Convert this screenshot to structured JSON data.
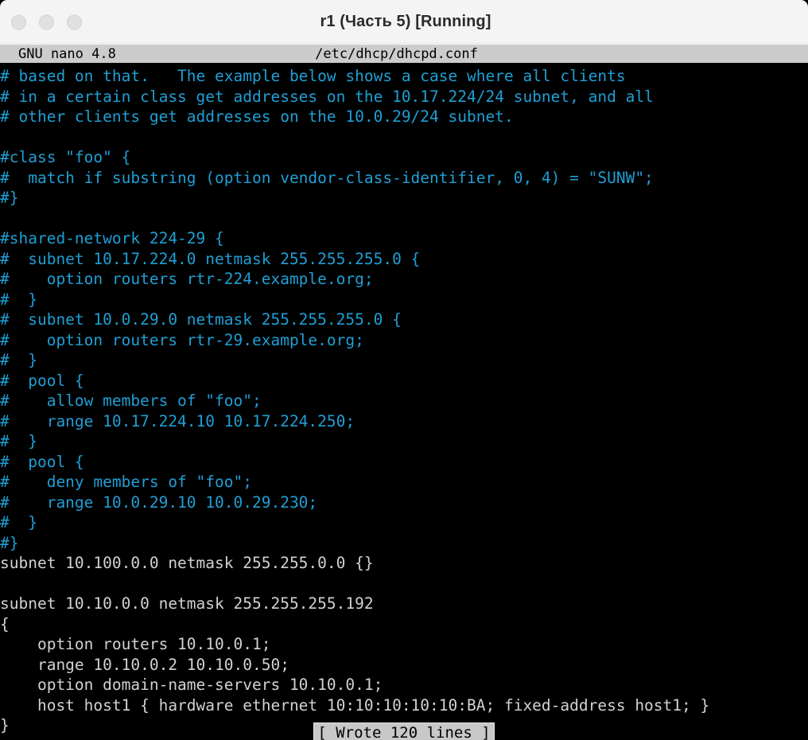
{
  "window": {
    "title": "r1 (Часть 5) [Running]",
    "controls": [
      {
        "name": "close-button",
        "label": ""
      },
      {
        "name": "minimize-button",
        "label": ""
      },
      {
        "name": "maximize-button",
        "label": ""
      }
    ]
  },
  "editor": {
    "app_name": "GNU nano 4.8",
    "file_path": "/etc/dhcp/dhcpd.conf",
    "status_message": "[ Wrote 120 lines ]",
    "colors": {
      "background": "#000000",
      "comment": "#1f9fd4",
      "text": "#d2d2d2",
      "header_bg": "#cccccc",
      "header_fg": "#000000",
      "titlebar_bg": "#f4f4f4"
    },
    "lines": [
      {
        "kind": "comment",
        "text": "# based on that.   The example below shows a case where all clients"
      },
      {
        "kind": "comment",
        "text": "# in a certain class get addresses on the 10.17.224/24 subnet, and all"
      },
      {
        "kind": "comment",
        "text": "# other clients get addresses on the 10.0.29/24 subnet."
      },
      {
        "kind": "blank",
        "text": ""
      },
      {
        "kind": "comment",
        "text": "#class \"foo\" {"
      },
      {
        "kind": "comment",
        "text": "#  match if substring (option vendor-class-identifier, 0, 4) = \"SUNW\";"
      },
      {
        "kind": "comment",
        "text": "#}"
      },
      {
        "kind": "blank",
        "text": ""
      },
      {
        "kind": "comment",
        "text": "#shared-network 224-29 {"
      },
      {
        "kind": "comment",
        "text": "#  subnet 10.17.224.0 netmask 255.255.255.0 {"
      },
      {
        "kind": "comment",
        "text": "#    option routers rtr-224.example.org;"
      },
      {
        "kind": "comment",
        "text": "#  }"
      },
      {
        "kind": "comment",
        "text": "#  subnet 10.0.29.0 netmask 255.255.255.0 {"
      },
      {
        "kind": "comment",
        "text": "#    option routers rtr-29.example.org;"
      },
      {
        "kind": "comment",
        "text": "#  }"
      },
      {
        "kind": "comment",
        "text": "#  pool {"
      },
      {
        "kind": "comment",
        "text": "#    allow members of \"foo\";"
      },
      {
        "kind": "comment",
        "text": "#    range 10.17.224.10 10.17.224.250;"
      },
      {
        "kind": "comment",
        "text": "#  }"
      },
      {
        "kind": "comment",
        "text": "#  pool {"
      },
      {
        "kind": "comment",
        "text": "#    deny members of \"foo\";"
      },
      {
        "kind": "comment",
        "text": "#    range 10.0.29.10 10.0.29.230;"
      },
      {
        "kind": "comment",
        "text": "#  }"
      },
      {
        "kind": "comment",
        "text": "#}"
      },
      {
        "kind": "text",
        "text": "subnet 10.100.0.0 netmask 255.255.0.0 {}"
      },
      {
        "kind": "blank",
        "text": ""
      },
      {
        "kind": "text",
        "text": "subnet 10.10.0.0 netmask 255.255.255.192"
      },
      {
        "kind": "text",
        "text": "{"
      },
      {
        "kind": "text",
        "text": "    option routers 10.10.0.1;"
      },
      {
        "kind": "text",
        "text": "    range 10.10.0.2 10.10.0.50;"
      },
      {
        "kind": "text",
        "text": "    option domain-name-servers 10.10.0.1;"
      },
      {
        "kind": "text",
        "text": "    host host1 { hardware ethernet 10:10:10:10:10:BA; fixed-address host1; }"
      },
      {
        "kind": "text",
        "text": "}"
      }
    ]
  }
}
